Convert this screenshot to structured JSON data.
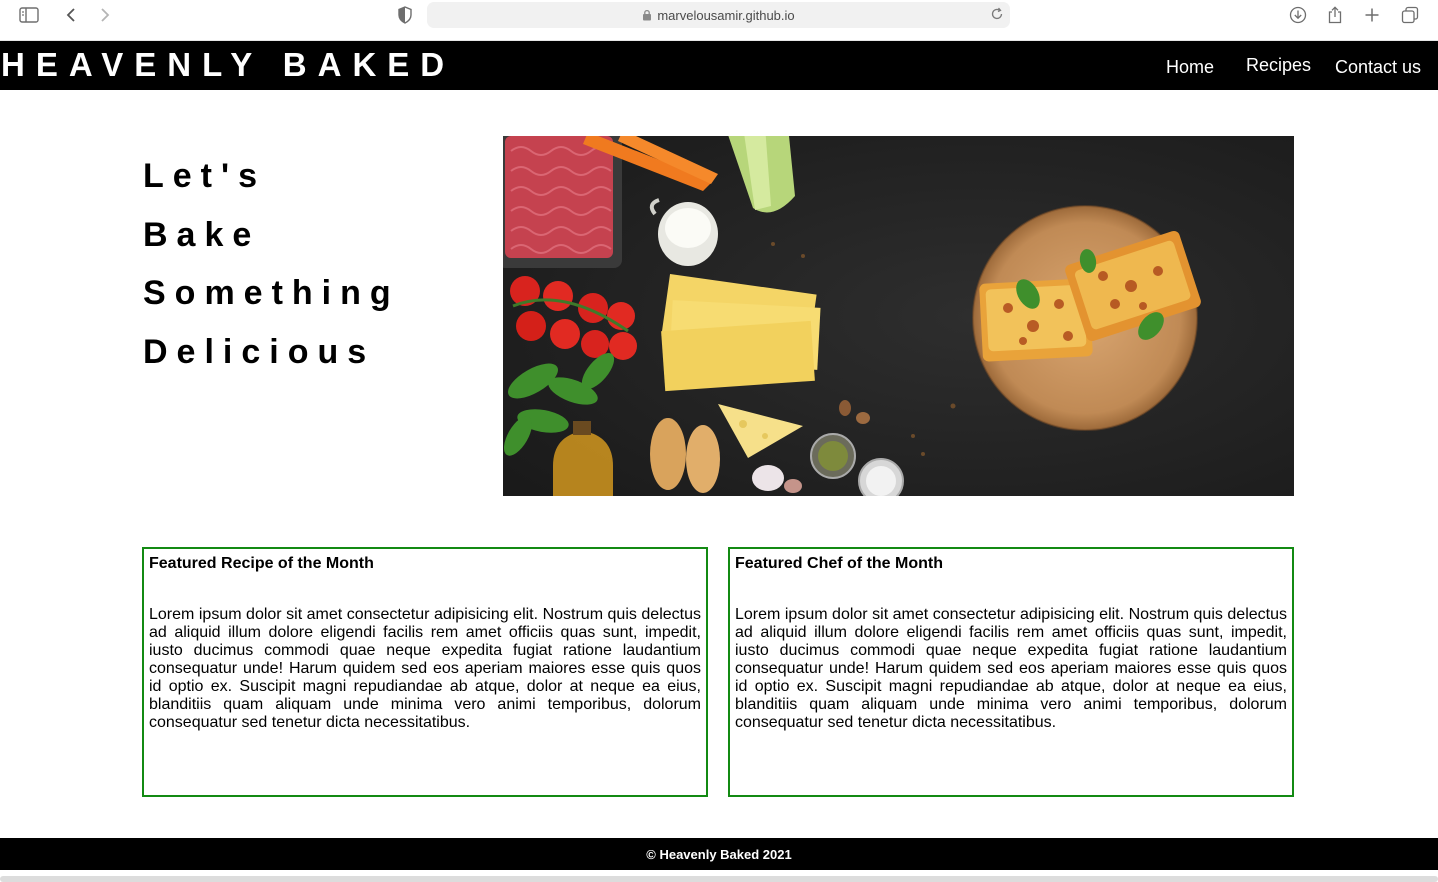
{
  "browser": {
    "url": "marvelousamir.github.io",
    "icons": [
      "sidebar-icon",
      "back-icon",
      "forward-icon",
      "shield-icon",
      "lock-icon",
      "reload-icon",
      "download-icon",
      "share-icon",
      "new-tab-icon",
      "tabs-overview-icon"
    ]
  },
  "nav": {
    "brand": "HEAVENLY BAKED",
    "links": [
      "Home",
      "Recipes",
      "Contact us"
    ]
  },
  "hero": {
    "lines": [
      "Let's",
      "Bake",
      "Something",
      "Delicious"
    ]
  },
  "cards": [
    {
      "title": "Featured Recipe of the Month",
      "body": "Lorem ipsum dolor sit amet consectetur adipisicing elit. Nostrum quis delectus ad aliquid illum dolore eligendi facilis rem amet officiis quas sunt, impedit, iusto ducimus commodi quae neque expedita fugiat ratione laudantium consequatur unde! Harum quidem sed eos aperiam maiores esse quis quos id optio ex. Suscipit magni repudiandae ab atque, dolor at neque ea eius, blanditiis quam aliquam unde minima vero animi temporibus, dolorum consequatur sed tenetur dicta necessitatibus."
    },
    {
      "title": "Featured Chef of the Month",
      "body": "Lorem ipsum dolor sit amet consectetur adipisicing elit. Nostrum quis delectus ad aliquid illum dolore eligendi facilis rem amet officiis quas sunt, impedit, iusto ducimus commodi quae neque expedita fugiat ratione laudantium consequatur unde! Harum quidem sed eos aperiam maiores esse quis quos id optio ex. Suscipit magni repudiandae ab atque, dolor at neque ea eius, blanditiis quam aliquam unde minima vero animi temporibus, dolorum consequatur sed tenetur dicta necessitatibus."
    }
  ],
  "footer": {
    "text": "© Heavenly Baked 2021"
  },
  "colors": {
    "nav_bg": "#000000",
    "card_border": "#138a13",
    "footer_bg": "#000000"
  }
}
